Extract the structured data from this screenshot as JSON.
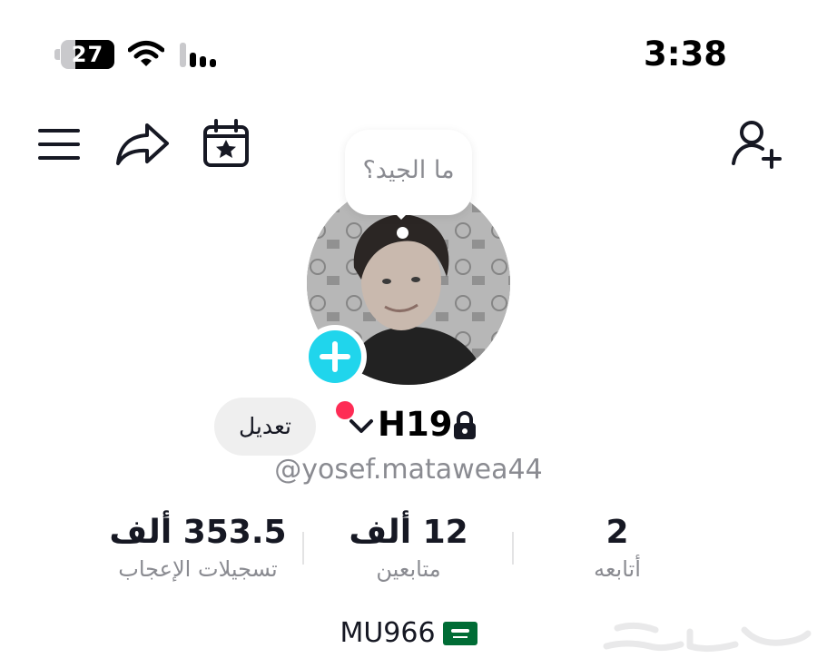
{
  "status_bar": {
    "battery_level": "27",
    "battery_fraction": 0.27,
    "time": "3:38"
  },
  "icons": {
    "menu": "hamburger-menu-icon",
    "share": "share-arrow-icon",
    "calendar": "calendar-star-icon",
    "add_user": "add-user-icon",
    "lock": "lock-icon",
    "chevron": "chevron-down-icon",
    "plus": "plus-icon",
    "flag": "saudi-flag-icon"
  },
  "bubble": {
    "text": "ما الجيد؟"
  },
  "profile": {
    "edit_label": "تعديل",
    "display_name": "H19",
    "username": "@yosef.matawea44",
    "bio": "MU966"
  },
  "stats": {
    "likes": {
      "value": "353.5 ألف",
      "label": "تسجيلات الإعجاب"
    },
    "followers": {
      "value": "12 ألف",
      "label": "متابعين"
    },
    "following": {
      "value": "2",
      "label": "أتابعه"
    }
  },
  "colors": {
    "accent_cyan": "#20d5ec",
    "notification_red": "#fe2c55",
    "text_primary": "#161823",
    "text_secondary": "#8a8b91",
    "button_bg": "#efefef"
  }
}
